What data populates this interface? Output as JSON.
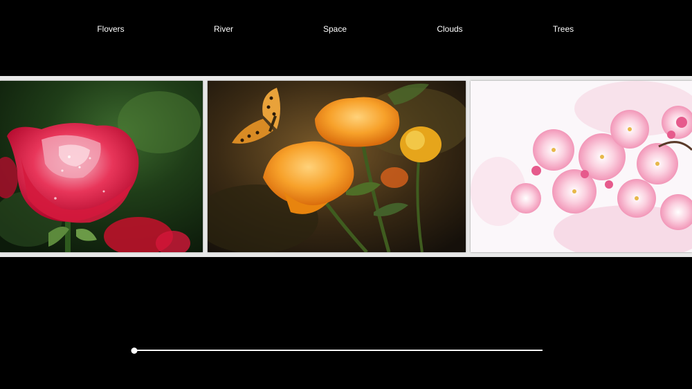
{
  "nav": {
    "items": [
      {
        "label": "Flovers"
      },
      {
        "label": "River"
      },
      {
        "label": "Space"
      },
      {
        "label": "Clouds"
      },
      {
        "label": "Trees"
      }
    ]
  },
  "gallery": {
    "photos": [
      {
        "subject": "red rose with water droplets",
        "icon": "rose-photo"
      },
      {
        "subject": "orange flowers with butterfly",
        "icon": "orange-flowers-photo"
      },
      {
        "subject": "pink cherry blossoms",
        "icon": "cherry-blossom-photo"
      }
    ]
  },
  "slider": {
    "value": 0,
    "min": 0,
    "max": 100
  },
  "colors": {
    "background": "#000000",
    "text": "#ffffff",
    "gallery_frame": "#e9e9e9"
  }
}
